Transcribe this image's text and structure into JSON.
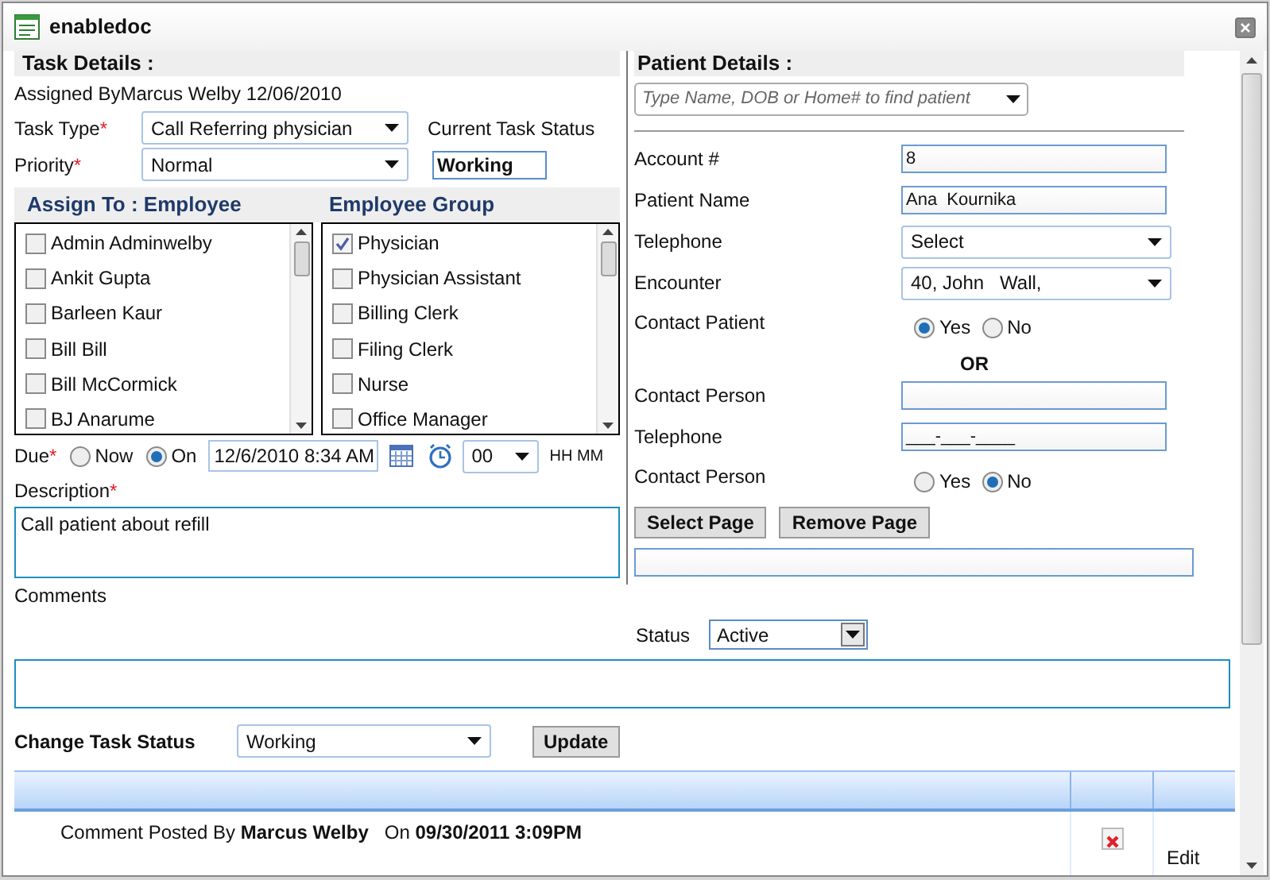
{
  "window": {
    "title": "enabledoc"
  },
  "task": {
    "heading": "Task Details :",
    "assigned_by": "Assigned ByMarcus Welby 12/06/2010",
    "task_type": {
      "label": "Task Type",
      "mark": "*",
      "value": "Call Referring physician"
    },
    "priority": {
      "label": "Priority",
      "mark": "*",
      "value": "Normal"
    },
    "current_status": {
      "label": "Current Task Status",
      "value": "Working"
    },
    "employees": {
      "heading": "Assign To : Employee",
      "items": [
        {
          "label": "Admin Adminwelby",
          "checked": false
        },
        {
          "label": "Ankit Gupta",
          "checked": false
        },
        {
          "label": "Barleen Kaur",
          "checked": false
        },
        {
          "label": "Bill Bill",
          "checked": false
        },
        {
          "label": "Bill McCormick",
          "checked": false
        },
        {
          "label": "BJ Anarume",
          "checked": false
        }
      ]
    },
    "groups": {
      "heading": "Employee Group",
      "items": [
        {
          "label": "Physician",
          "checked": true
        },
        {
          "label": "Physician Assistant",
          "checked": false
        },
        {
          "label": "Billing Clerk",
          "checked": false
        },
        {
          "label": "Filing Clerk",
          "checked": false
        },
        {
          "label": "Nurse",
          "checked": false
        },
        {
          "label": "Office Manager",
          "checked": false
        }
      ]
    },
    "due": {
      "label": "Due",
      "mark": "*",
      "options": [
        {
          "label": "Now",
          "selected": false
        },
        {
          "label": "On",
          "selected": true
        }
      ],
      "date": "12/6/2010 8:34 AM",
      "minutes": "00",
      "unit": "HH MM"
    },
    "description": {
      "label": "Description",
      "mark": "*",
      "value": "Call patient about refill"
    },
    "comments_label": "Comments"
  },
  "patient": {
    "heading": "Patient Details :",
    "search_placeholder": "Type Name, DOB or Home# to find patient",
    "fields": [
      {
        "kind": "input",
        "label": "Account #",
        "value": "8"
      },
      {
        "kind": "input",
        "label": "Patient Name",
        "value": "Ana  Kournika"
      },
      {
        "kind": "select",
        "label": "Telephone",
        "value": "Select"
      },
      {
        "kind": "select",
        "label": "Encounter",
        "value": "40, John   Wall,"
      },
      {
        "kind": "radio",
        "label": "Contact Patient",
        "options": [
          {
            "label": "Yes",
            "selected": true
          },
          {
            "label": "No",
            "selected": false
          }
        ]
      },
      {
        "kind": "separator",
        "label": "OR"
      },
      {
        "kind": "input",
        "label": "Contact Person"
      },
      {
        "kind": "input",
        "label": "Telephone",
        "value": "___-___-____"
      },
      {
        "kind": "radio",
        "label": "Contact Person",
        "options": [
          {
            "label": "Yes",
            "selected": false
          },
          {
            "label": "No",
            "selected": true
          }
        ]
      }
    ],
    "buttons": [
      "Select Page",
      "Remove Page"
    ]
  },
  "status": {
    "label": "Status",
    "value": "Active"
  },
  "change_status": {
    "label": "Change Task Status",
    "value": "Working",
    "button": "Update"
  },
  "comments_grid": {
    "rows": [
      {
        "text": "Comment Posted By **Marcus Welby**   On **09/30/2011 3:09PM**",
        "action": "Edit"
      }
    ]
  }
}
